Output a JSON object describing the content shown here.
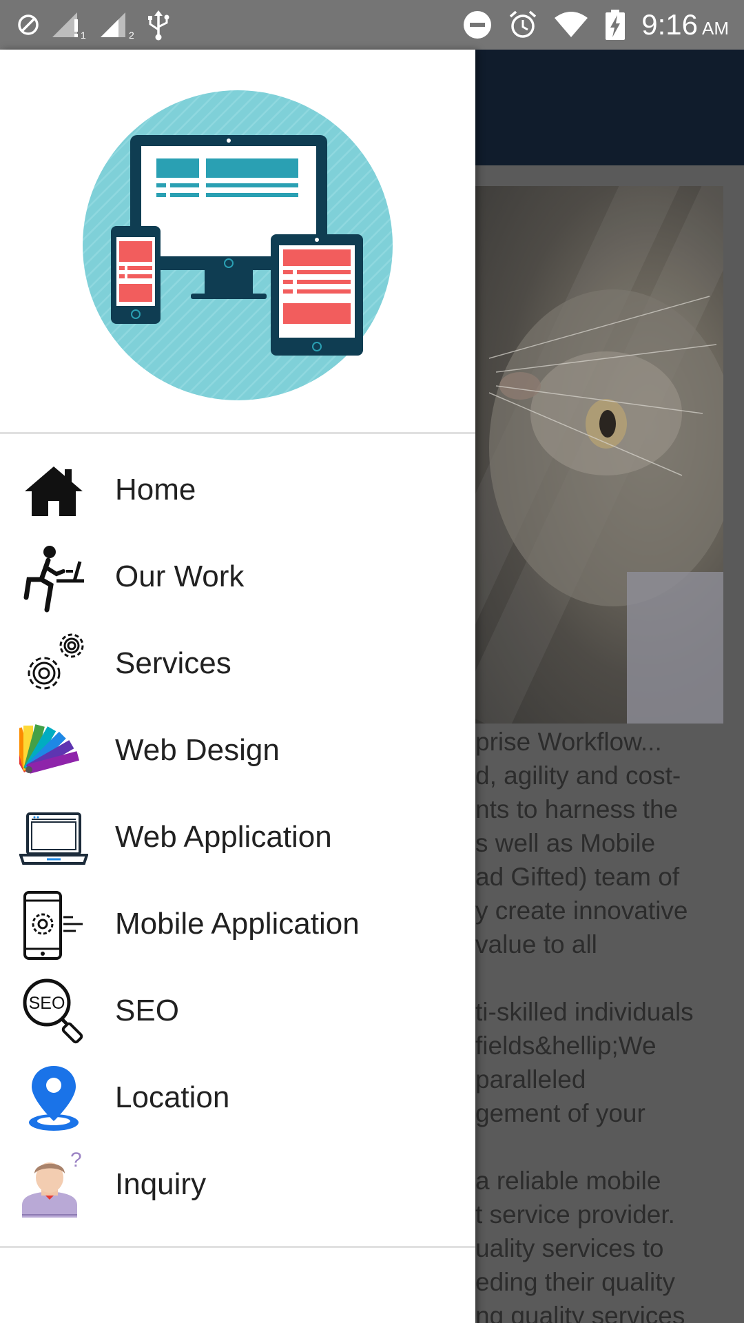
{
  "status_bar": {
    "time": "9:16",
    "ampm": "AM",
    "icons": [
      "do-not-disturb-icon",
      "signal-sim1-icon",
      "signal-sim2-icon",
      "usb-icon",
      "dnd-minus-icon",
      "alarm-icon",
      "wifi-icon",
      "battery-charging-icon"
    ]
  },
  "drawer": {
    "logo": "responsive-devices-logo",
    "menu": [
      {
        "label": "Home",
        "icon": "home-icon"
      },
      {
        "label": "Our Work",
        "icon": "person-at-desk-icon"
      },
      {
        "label": "Services",
        "icon": "gears-icon"
      },
      {
        "label": "Web Design",
        "icon": "color-palette-icon"
      },
      {
        "label": "Web Application",
        "icon": "laptop-icon"
      },
      {
        "label": "Mobile Application",
        "icon": "mobile-settings-icon"
      },
      {
        "label": "SEO",
        "icon": "seo-magnifier-icon"
      },
      {
        "label": "Location",
        "icon": "location-pin-icon"
      },
      {
        "label": "Inquiry",
        "icon": "inquiry-person-icon"
      }
    ]
  },
  "background_content": {
    "lines": [
      "prise Workflow...",
      "d, agility and cost-",
      "nts to harness the",
      "s well as Mobile",
      "ad Gifted) team of",
      "y create innovative",
      "value to all",
      "",
      "ti-skilled individuals",
      " fields&hellip;We",
      "paralleled",
      "gement of your",
      "",
      " a reliable mobile",
      "t service provider.",
      "uality services to",
      "eding their quality",
      "ng quality services"
    ]
  },
  "colors": {
    "status_bar": "#757575",
    "toolbar": "#101c2c",
    "logo_circle": "#7fd0d8",
    "device_frame": "#0f3d52",
    "accent_red": "#f25d5d",
    "accent_teal": "#2aa0b3",
    "location_blue": "#1a73e8"
  }
}
